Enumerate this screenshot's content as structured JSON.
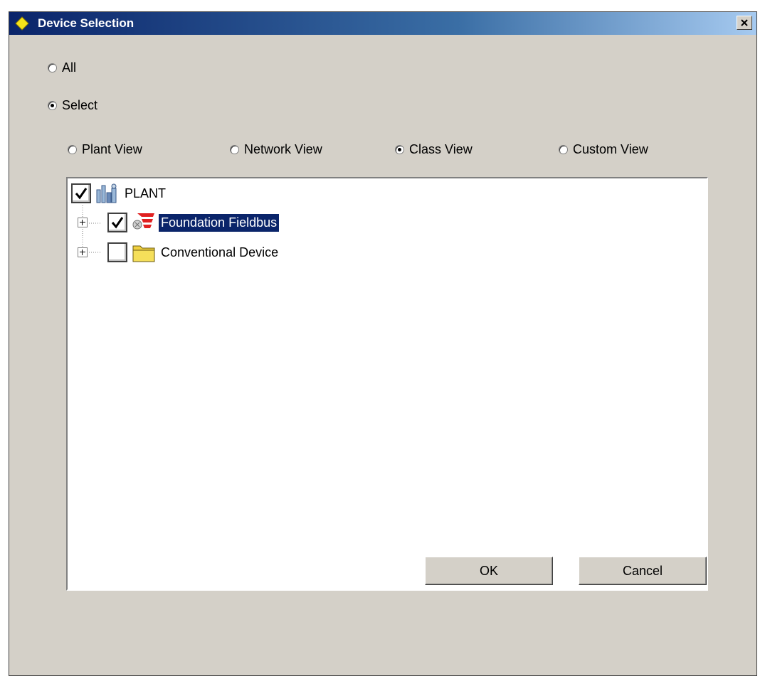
{
  "window": {
    "title": "Device Selection"
  },
  "scope": {
    "options": [
      {
        "label": "All",
        "selected": false
      },
      {
        "label": "Select",
        "selected": true
      }
    ]
  },
  "views": [
    {
      "label": "Plant View",
      "selected": false
    },
    {
      "label": "Network View",
      "selected": false
    },
    {
      "label": "Class View",
      "selected": true
    },
    {
      "label": "Custom View",
      "selected": false
    }
  ],
  "tree": {
    "root": {
      "label": "PLANT",
      "checked": true,
      "icon": "plant-icon"
    },
    "children": [
      {
        "label": "Foundation Fieldbus",
        "checked": true,
        "selected": true,
        "icon": "fieldbus-icon"
      },
      {
        "label": "Conventional Device",
        "checked": false,
        "selected": false,
        "icon": "folder-icon"
      }
    ]
  },
  "buttons": {
    "ok": "OK",
    "cancel": "Cancel"
  },
  "colors": {
    "title_bar": "#0a246a",
    "selection": "#0a246a",
    "dialog_bg": "#d4d0c8"
  }
}
